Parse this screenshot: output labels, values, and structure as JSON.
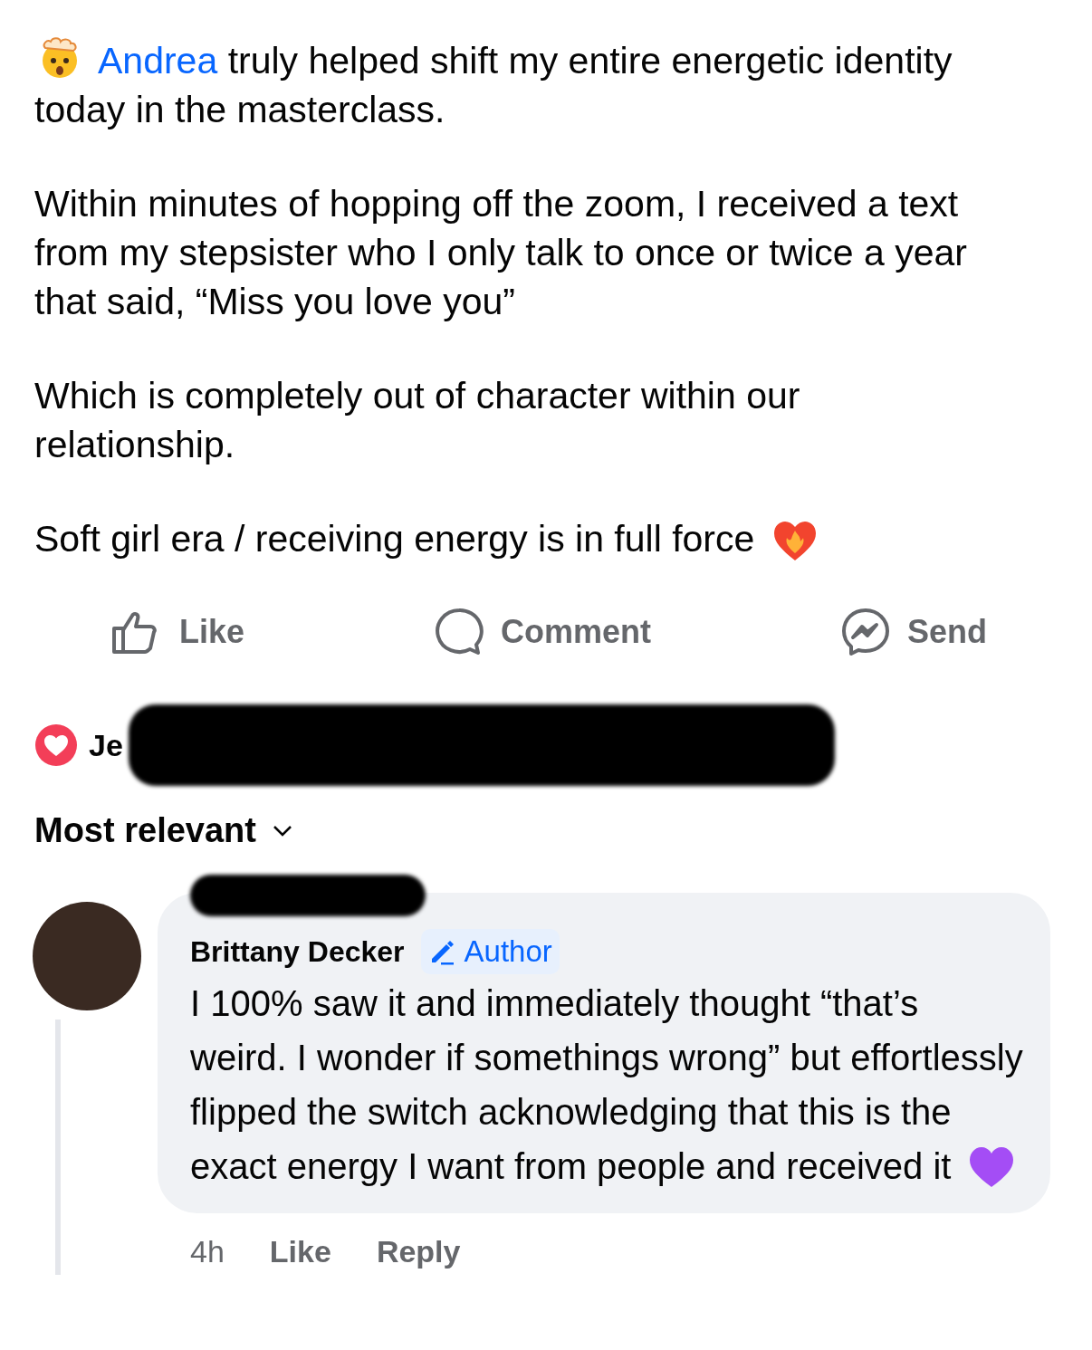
{
  "post": {
    "mention": "Andrea",
    "paragraphs": [
      "truly helped shift my entire energetic identity today in the masterclass.",
      "Within minutes of hopping off the zoom, I received a text from my stepsister who I only talk to once or twice a year that said, “Miss you love you”",
      "Which is completely out of character within our relationship.",
      "Soft girl era / receiving energy is in full force"
    ]
  },
  "actions": [
    {
      "kind": "like",
      "label": "Like"
    },
    {
      "kind": "comment",
      "label": "Comment"
    },
    {
      "kind": "send",
      "label": "Send"
    }
  ],
  "reactions": {
    "names": "Je"
  },
  "sort": {
    "label": "Most relevant"
  },
  "comment": {
    "author": "Brittany Decker",
    "badge": "Author",
    "text": "I 100% saw it and immediately thought “that’s weird. I wonder if somethings wrong” but effortlessly flipped the switch acknowledging that this is the exact energy I want from people and received it",
    "time": "4h",
    "actions": [
      "Like",
      "Reply"
    ]
  }
}
